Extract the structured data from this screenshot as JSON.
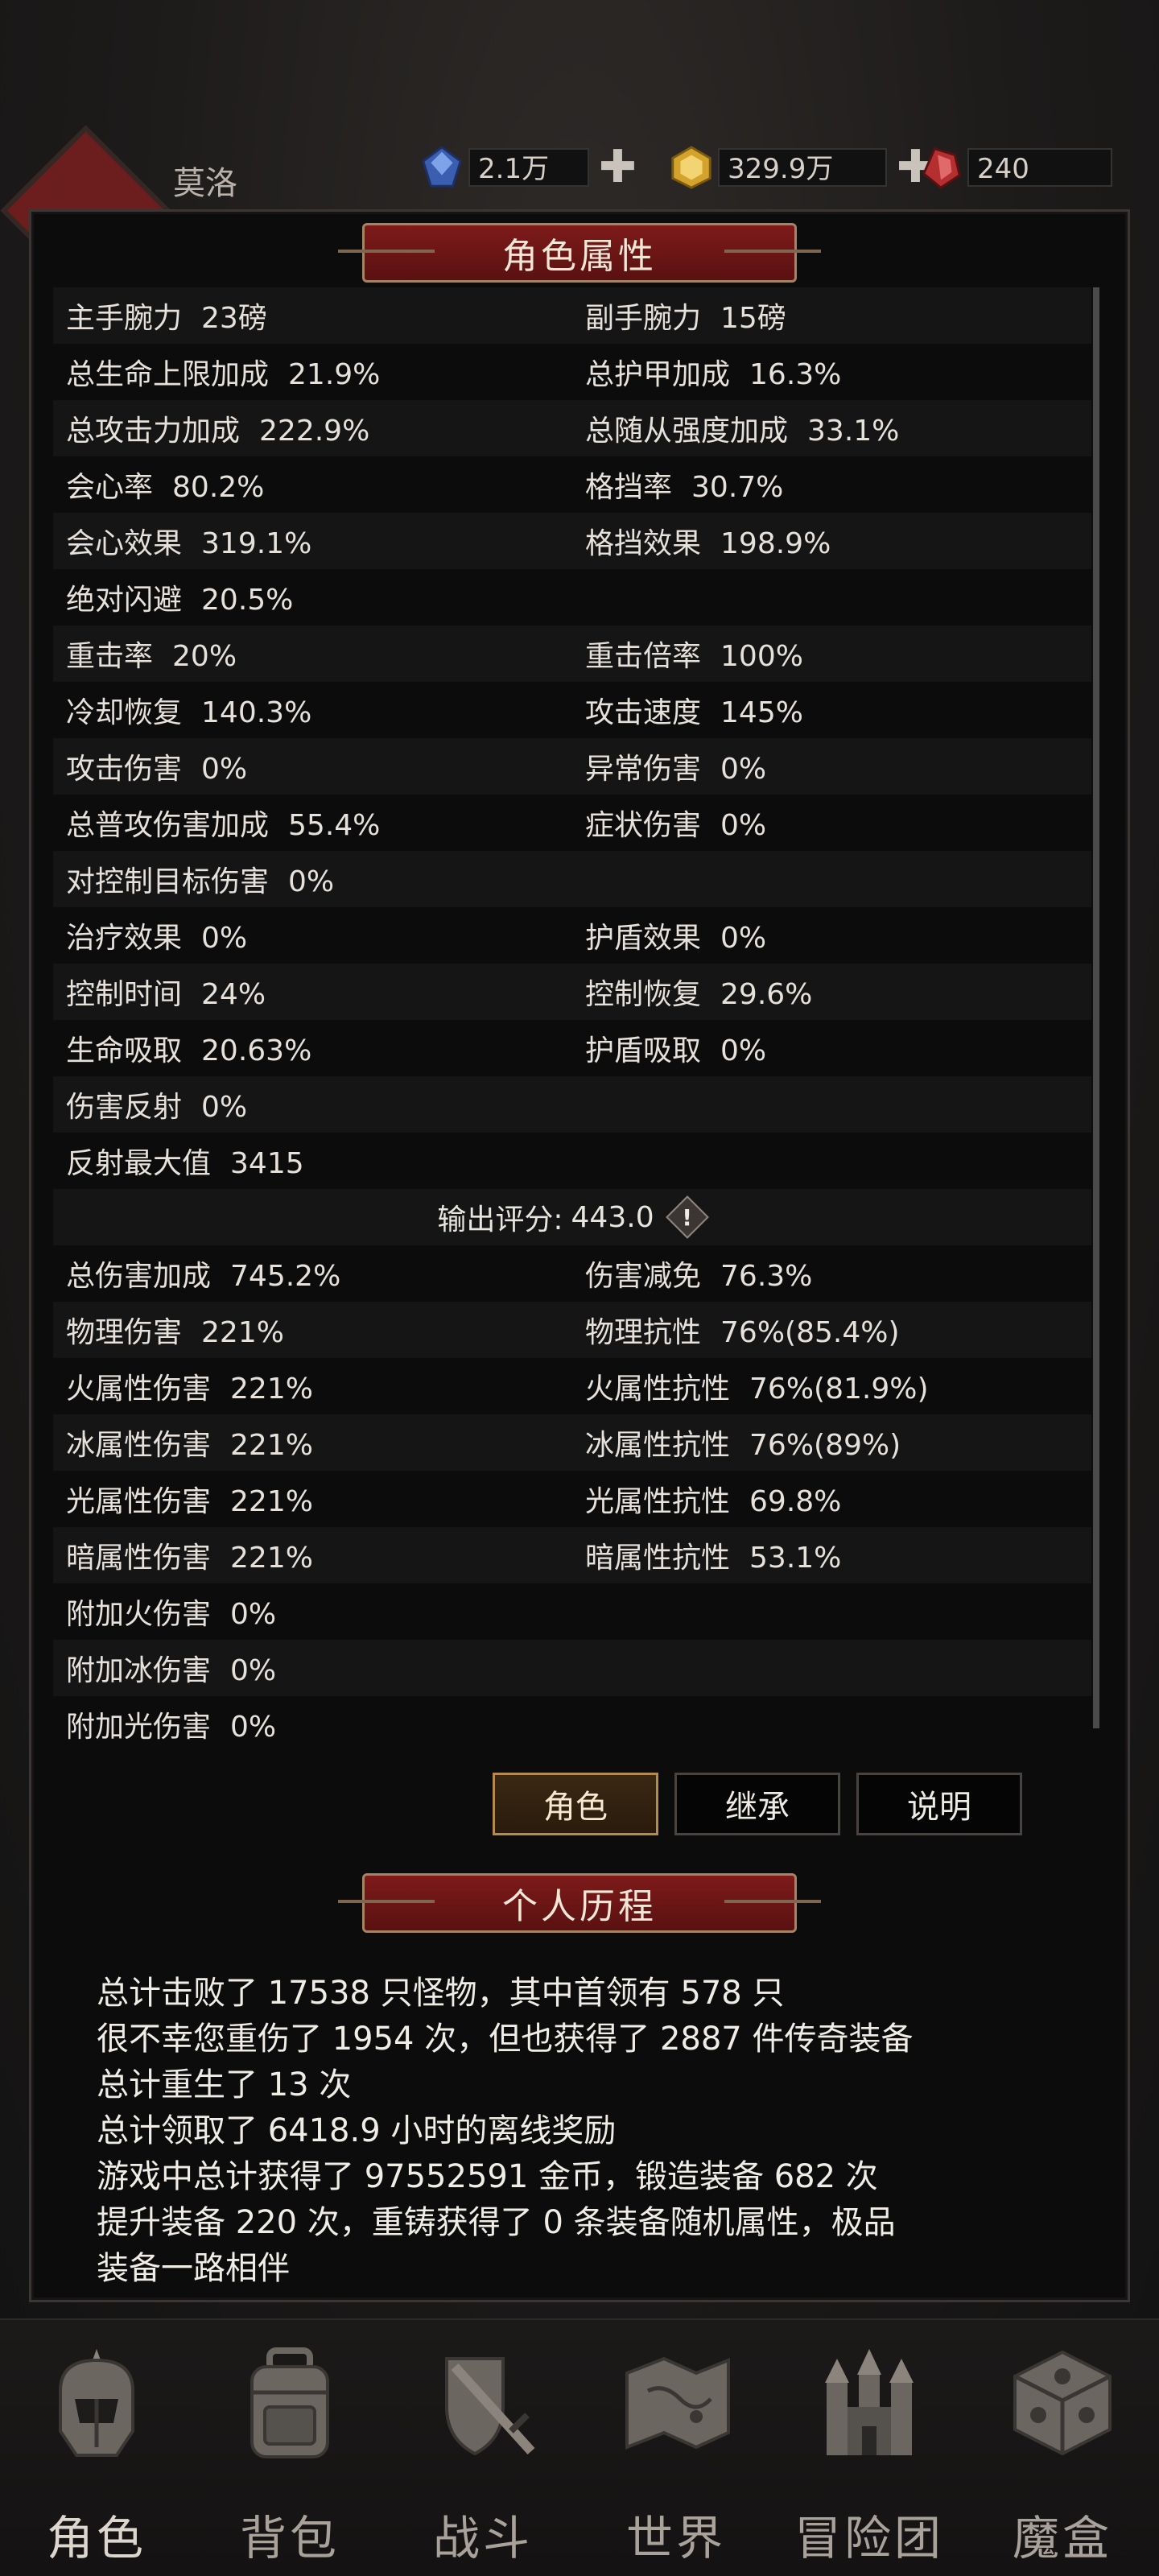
{
  "header": {
    "player_name": "莫洛",
    "currencies": [
      {
        "icon": "blue-gem-icon",
        "value": "2.1万",
        "color": "#3a5fb0"
      },
      {
        "icon": "gold-gem-icon",
        "value": "329.9万",
        "color": "#d4a32c"
      },
      {
        "icon": "red-gem-icon",
        "value": "240",
        "color": "#b43030"
      }
    ]
  },
  "stats_panel": {
    "title": "角色属性",
    "rows": [
      {
        "l_k": "主手腕力",
        "l_v": "23磅",
        "r_k": "副手腕力",
        "r_v": "15磅"
      },
      {
        "l_k": "总生命上限加成",
        "l_v": "21.9%",
        "r_k": "总护甲加成",
        "r_v": "16.3%"
      },
      {
        "l_k": "总攻击力加成",
        "l_v": "222.9%",
        "r_k": "总随从强度加成",
        "r_v": "33.1%"
      },
      {
        "l_k": "会心率",
        "l_v": "80.2%",
        "r_k": "格挡率",
        "r_v": "30.7%"
      },
      {
        "l_k": "会心效果",
        "l_v": "319.1%",
        "r_k": "格挡效果",
        "r_v": "198.9%"
      },
      {
        "l_k": "绝对闪避",
        "l_v": "20.5%",
        "r_k": "",
        "r_v": ""
      },
      {
        "l_k": "重击率",
        "l_v": "20%",
        "r_k": "重击倍率",
        "r_v": "100%"
      },
      {
        "l_k": "冷却恢复",
        "l_v": "140.3%",
        "r_k": "攻击速度",
        "r_v": "145%"
      },
      {
        "l_k": "攻击伤害",
        "l_v": "0%",
        "r_k": "异常伤害",
        "r_v": "0%"
      },
      {
        "l_k": "总普攻伤害加成",
        "l_v": "55.4%",
        "r_k": "症状伤害",
        "r_v": "0%"
      },
      {
        "l_k": "对控制目标伤害",
        "l_v": "0%",
        "r_k": "",
        "r_v": ""
      },
      {
        "l_k": "治疗效果",
        "l_v": "0%",
        "r_k": "护盾效果",
        "r_v": "0%"
      },
      {
        "l_k": "控制时间",
        "l_v": "24%",
        "r_k": "控制恢复",
        "r_v": "29.6%"
      },
      {
        "l_k": "生命吸取",
        "l_v": "20.63%",
        "r_k": "护盾吸取",
        "r_v": "0%"
      },
      {
        "l_k": "伤害反射",
        "l_v": "0%",
        "r_k": "",
        "r_v": ""
      },
      {
        "l_k": "反射最大值",
        "l_v": "3415",
        "r_k": "",
        "r_v": ""
      }
    ],
    "score_label": "输出评分:",
    "score_value": "443.0",
    "score_info": "!",
    "rows2": [
      {
        "l_k": "总伤害加成",
        "l_v": "745.2%",
        "r_k": "伤害减免",
        "r_v": "76.3%"
      },
      {
        "l_k": "物理伤害",
        "l_v": "221%",
        "r_k": "物理抗性",
        "r_v": "76%(85.4%)"
      },
      {
        "l_k": "火属性伤害",
        "l_v": "221%",
        "r_k": "火属性抗性",
        "r_v": "76%(81.9%)"
      },
      {
        "l_k": "冰属性伤害",
        "l_v": "221%",
        "r_k": "冰属性抗性",
        "r_v": "76%(89%)"
      },
      {
        "l_k": "光属性伤害",
        "l_v": "221%",
        "r_k": "光属性抗性",
        "r_v": "69.8%"
      },
      {
        "l_k": "暗属性伤害",
        "l_v": "221%",
        "r_k": "暗属性抗性",
        "r_v": "53.1%"
      },
      {
        "l_k": "附加火伤害",
        "l_v": "0%",
        "r_k": "",
        "r_v": ""
      },
      {
        "l_k": "附加冰伤害",
        "l_v": "0%",
        "r_k": "",
        "r_v": ""
      },
      {
        "l_k": "附加光伤害",
        "l_v": "0%",
        "r_k": "",
        "r_v": ""
      }
    ]
  },
  "buttons": {
    "role": "角色",
    "inherit": "继承",
    "explain": "说明"
  },
  "history": {
    "title": "个人历程",
    "lines": [
      "总计击败了 17538 只怪物，其中首领有 578 只",
      "很不幸您重伤了 1954 次，但也获得了 2887 件传奇装备",
      "总计重生了 13 次",
      "总计领取了 6418.9 小时的离线奖励",
      "游戏中总计获得了 97552591 金币，锻造装备 682 次",
      "提升装备 220 次，重铸获得了 0 条装备随机属性，极品",
      "装备一路相伴"
    ]
  },
  "nav": [
    {
      "label": "角色",
      "icon": "knight-helmet-icon"
    },
    {
      "label": "背包",
      "icon": "backpack-icon"
    },
    {
      "label": "战斗",
      "icon": "shield-sword-icon"
    },
    {
      "label": "世界",
      "icon": "world-map-icon"
    },
    {
      "label": "冒险团",
      "icon": "castle-icon"
    },
    {
      "label": "魔盒",
      "icon": "magic-box-icon"
    }
  ]
}
